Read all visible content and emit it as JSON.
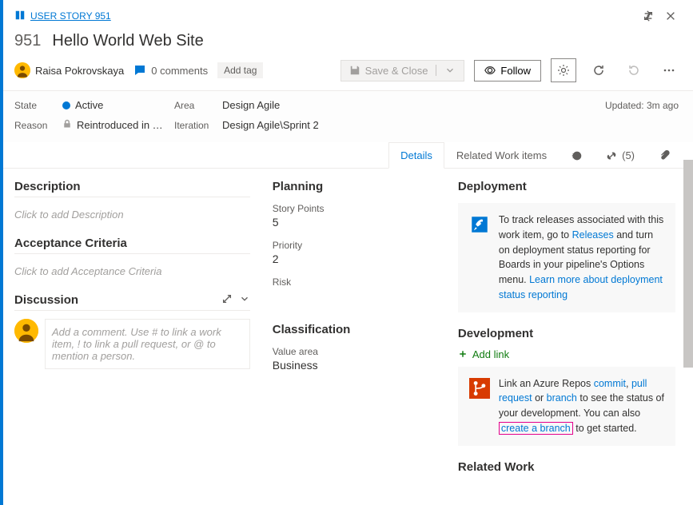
{
  "breadcrumb": {
    "type_label": "USER STORY 951"
  },
  "work_item": {
    "id": "951",
    "title": "Hello World Web Site"
  },
  "assignee": {
    "name": "Raisa Pokrovskaya"
  },
  "comments": {
    "count_label": "0 comments"
  },
  "add_tag_label": "Add tag",
  "toolbar": {
    "save_label": "Save & Close",
    "follow_label": "Follow"
  },
  "state": {
    "state_label": "State",
    "state_value": "Active",
    "reason_label": "Reason",
    "reason_value": "Reintroduced in …",
    "area_label": "Area",
    "area_value": "Design Agile",
    "iteration_label": "Iteration",
    "iteration_value": "Design Agile\\Sprint 2",
    "updated_label": "Updated: 3m ago"
  },
  "tabs": {
    "details": "Details",
    "related": "Related Work items",
    "links_count": "(5)"
  },
  "left": {
    "description_h": "Description",
    "description_ph": "Click to add Description",
    "acceptance_h": "Acceptance Criteria",
    "acceptance_ph": "Click to add Acceptance Criteria",
    "discussion_h": "Discussion",
    "comment_ph": "Add a comment. Use # to link a work item, ! to link a pull request, or @ to mention a person."
  },
  "mid": {
    "planning_h": "Planning",
    "story_points_label": "Story Points",
    "story_points_value": "5",
    "priority_label": "Priority",
    "priority_value": "2",
    "risk_label": "Risk",
    "classification_h": "Classification",
    "value_area_label": "Value area",
    "value_area_value": "Business"
  },
  "right": {
    "deployment_h": "Deployment",
    "deploy_pre": "To track releases associated with this work item, go to ",
    "deploy_link1": "Releases",
    "deploy_mid": " and turn on deployment status reporting for Boards in your pipeline's Options menu. ",
    "deploy_link2": "Learn more about deployment status reporting",
    "development_h": "Development",
    "add_link_label": "Add link",
    "dev_pre": "Link an Azure Repos ",
    "dev_commit": "commit",
    "dev_sep1": ", ",
    "dev_pr": "pull request",
    "dev_sep2": " or ",
    "dev_branch": "branch",
    "dev_mid": " to see the status of your development. You can also ",
    "dev_create": "create a branch",
    "dev_end": " to get started.",
    "related_h": "Related Work"
  }
}
